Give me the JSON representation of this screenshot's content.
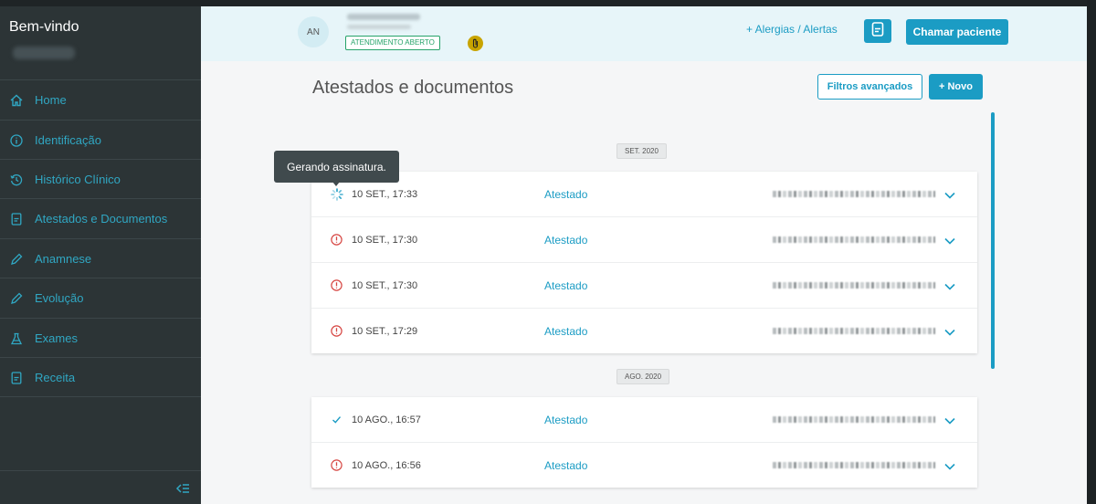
{
  "sidebar": {
    "welcome": "Bem-vindo",
    "items": [
      {
        "label": "Home",
        "icon": "home-icon"
      },
      {
        "label": "Identificação",
        "icon": "info-icon"
      },
      {
        "label": "Histórico Clínico",
        "icon": "history-icon"
      },
      {
        "label": "Atestados e Documentos",
        "icon": "document-icon"
      },
      {
        "label": "Anamnese",
        "icon": "pencil-icon"
      },
      {
        "label": "Evolução",
        "icon": "pencil-icon"
      },
      {
        "label": "Exames",
        "icon": "flask-icon"
      },
      {
        "label": "Receita",
        "icon": "document-icon"
      }
    ]
  },
  "header": {
    "avatar_initials": "AN",
    "status": "ATENDIMENTO ABERTO",
    "alerts_link": "+ Alergias / Alertas",
    "call_button": "Chamar paciente"
  },
  "main": {
    "title": "Atestados e documentos",
    "filter_button": "Filtros avançados",
    "new_button": "+ Novo",
    "tooltip": "Gerando assinatura."
  },
  "groups": [
    {
      "month": "SET. 2020",
      "rows": [
        {
          "status": "loading",
          "datetime": "10 SET., 17:33",
          "type": "Atestado"
        },
        {
          "status": "error",
          "datetime": "10 SET., 17:30",
          "type": "Atestado"
        },
        {
          "status": "error",
          "datetime": "10 SET., 17:30",
          "type": "Atestado"
        },
        {
          "status": "error",
          "datetime": "10 SET., 17:29",
          "type": "Atestado"
        }
      ]
    },
    {
      "month": "AGO. 2020",
      "rows": [
        {
          "status": "success",
          "datetime": "10 AGO., 16:57",
          "type": "Atestado"
        },
        {
          "status": "error",
          "datetime": "10 AGO., 16:56",
          "type": "Atestado"
        }
      ]
    }
  ],
  "colors": {
    "accent": "#1b9cc4",
    "sidebar_bg": "#2c3436",
    "sidebar_label": "#30a7c3",
    "error": "#d64541",
    "success": "#1b9cc4",
    "status_green": "#27a36a"
  }
}
